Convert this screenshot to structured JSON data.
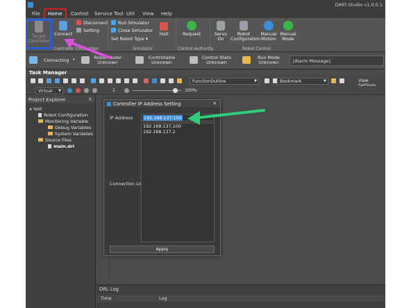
{
  "window": {
    "title": "DART-Studio v1.0.0.1"
  },
  "menu": {
    "items": [
      "File",
      "Home",
      "Control",
      "Service Tool",
      "Util",
      "View",
      "Help"
    ]
  },
  "ribbon": {
    "target_controller": "Target Controller",
    "connect": "Connect",
    "disconnect": "Disconnect",
    "setting": "Setting",
    "run_simulator": "Run Simulator",
    "close_simulator": "Close Simulator",
    "set_robot_type": "Set Robot Type",
    "halt": "Halt",
    "request": "Request",
    "servo_on": "Servo On",
    "robot_configuration": "Robot Configuration",
    "manual_motion": "Manual Motion",
    "manual_mode": "Manual Mode",
    "group_controller_connection": "Controller Connection",
    "group_simulator": "Simulator",
    "group_control_authority": "Control Authority",
    "group_robot_control": "Robot Control"
  },
  "status": {
    "connecting": "Connecting",
    "robot_model": "Robot Model",
    "robot_model_value": "Unknown",
    "controllable": "Controllable",
    "controllable_value": "Unknown",
    "control_state": "Control State",
    "control_state_value": "Unknown",
    "run_mode": "Run Mode",
    "run_mode_value": "Unknown",
    "alarm": "[Alarm Message]"
  },
  "task_manager": {
    "label": "Task Manager",
    "function_outline": "FunctionOutline",
    "bookmark": "Bookmark",
    "view_settings": "View Settings",
    "mode": "Virtual",
    "speed": "1",
    "zoom": "100%"
  },
  "explorer": {
    "title": "Project Explorer",
    "tree": [
      {
        "label": "test",
        "kind": "root"
      },
      {
        "label": "Robot Configuration",
        "kind": "doc"
      },
      {
        "label": "Monitoring Variable",
        "kind": "folder"
      },
      {
        "label": "Debug Variables",
        "kind": "folder"
      },
      {
        "label": "System Variables",
        "kind": "folder"
      },
      {
        "label": "Source Files",
        "kind": "folder"
      },
      {
        "label": "main.drl",
        "kind": "file"
      }
    ]
  },
  "dialog": {
    "title": "Controller IP Address Setting",
    "ip_label": "IP Address",
    "ip_value": "192.168.137.100",
    "list_label": "Connection List",
    "list": [
      "192.168.137.100",
      "192.168.137.2"
    ],
    "apply": "Apply"
  },
  "log": {
    "title": "DRL Log",
    "col_time": "Time",
    "col_log": "Log"
  },
  "colors": {
    "highlight_red": "#d21f1f",
    "highlight_blue": "#2c5fd6",
    "arrow_magenta": "#d84fd8",
    "arrow_green": "#2ecf7a",
    "selection": "#3c8ddc"
  }
}
